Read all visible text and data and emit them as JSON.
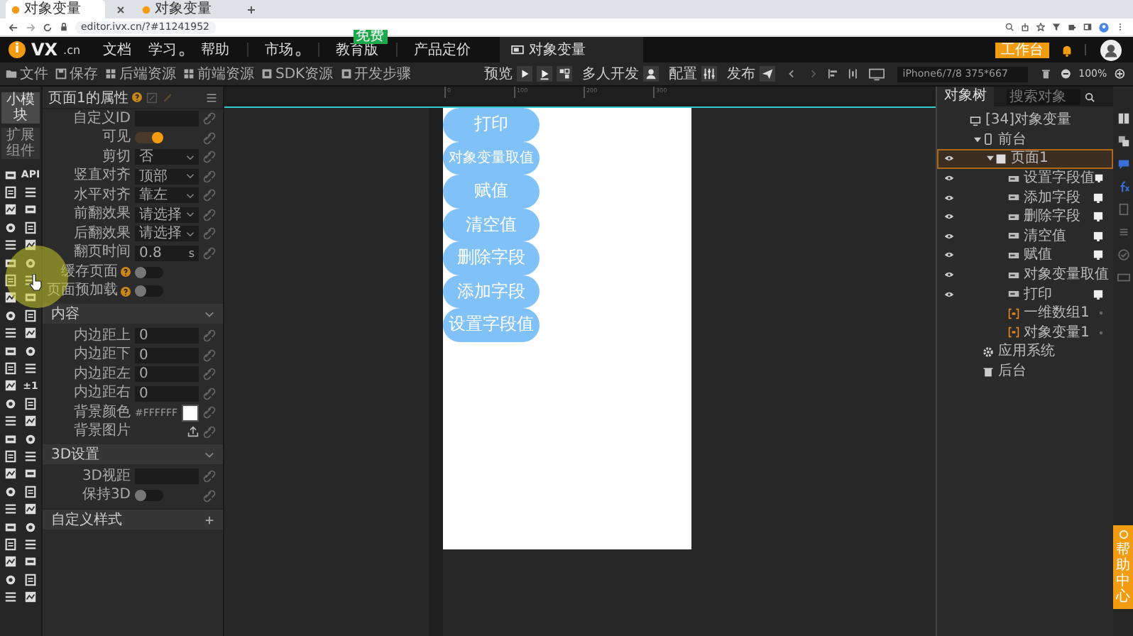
{
  "browser": {
    "tabs": [
      {
        "title": "对象变量",
        "selected": true
      },
      {
        "title": "对象变量",
        "selected": false
      }
    ],
    "address": "editor.ivx.cn/?#11241952"
  },
  "header": {
    "logo": {
      "mark": "i",
      "name": "VX",
      "domain": ".cn"
    },
    "nav": [
      {
        "label": "文档",
        "has_menu": false
      },
      {
        "label": "学习",
        "has_menu": true
      },
      {
        "label": "帮助",
        "has_menu": false
      },
      {
        "label": "市场",
        "has_menu": true
      },
      {
        "label": "教育版",
        "has_menu": false,
        "badge": "免费"
      },
      {
        "label": "产品定价",
        "has_menu": false
      }
    ],
    "project_tab": "对象变量",
    "workbench": "工作台"
  },
  "toolbar": {
    "files": [
      {
        "label": "文件"
      },
      {
        "label": "保存"
      },
      {
        "label": "后端资源"
      },
      {
        "label": "前端资源"
      },
      {
        "label": "SDK资源"
      },
      {
        "label": "开发步骤"
      }
    ],
    "preview": "预览",
    "collab": "多人开发",
    "config": "配置",
    "publish": "发布",
    "device": "iPhone6/7/8 375*667",
    "zoom": "100%"
  },
  "palette": {
    "tabs": [
      {
        "label": "小模块",
        "selected": true
      },
      {
        "label": "扩展组件",
        "selected": false
      }
    ],
    "labels": [
      "API",
      "±1"
    ]
  },
  "panel": {
    "title": "页面1的属性",
    "rows": [
      {
        "kind": "input",
        "label": "自定义ID",
        "link": true
      },
      {
        "kind": "toggle",
        "label": "可见",
        "on": true,
        "link": true
      },
      {
        "kind": "select",
        "label": "剪切",
        "value": "否",
        "link": true
      },
      {
        "kind": "select",
        "label": "竖直对齐",
        "value": "顶部",
        "link": true
      },
      {
        "kind": "select",
        "label": "水平对齐",
        "value": "靠左",
        "link": true
      },
      {
        "kind": "select",
        "label": "前翻效果",
        "value": "请选择",
        "link": true
      },
      {
        "kind": "select",
        "label": "后翻效果",
        "value": "请选择",
        "link": true
      },
      {
        "kind": "input",
        "label": "翻页时间",
        "value": "0.8",
        "unit": "s",
        "link": true
      },
      {
        "kind": "toggle",
        "label": "缓存页面",
        "help": true,
        "on": false,
        "link": false
      },
      {
        "kind": "toggle",
        "label": "页面预加载",
        "help": true,
        "on": false,
        "link": false
      }
    ],
    "sections": [
      {
        "kind": "group",
        "title": "内容",
        "expanded": true,
        "rows": [
          {
            "kind": "input",
            "label": "内边距上",
            "value": "0",
            "link": true
          },
          {
            "kind": "input",
            "label": "内边距下",
            "value": "0",
            "link": true
          },
          {
            "kind": "input",
            "label": "内边距左",
            "value": "0",
            "link": true
          },
          {
            "kind": "input",
            "label": "内边距右",
            "value": "0",
            "link": true
          },
          {
            "kind": "color",
            "label": "背景颜色",
            "value": "#FFFFFF",
            "color": "#ffffff",
            "link": true
          },
          {
            "kind": "upload",
            "label": "背景图片",
            "link": true
          }
        ]
      },
      {
        "kind": "group",
        "title": "3D设置",
        "expanded": true,
        "rows": [
          {
            "kind": "input",
            "label": "3D视距",
            "link": true
          },
          {
            "kind": "toggle",
            "label": "保持3D",
            "on": false,
            "link": true
          }
        ]
      },
      {
        "kind": "add",
        "title": "自定义样式"
      }
    ]
  },
  "canvas": {
    "ruler": [
      "0",
      "100",
      "200",
      "300"
    ],
    "buttons": [
      {
        "label": "打印"
      },
      {
        "label": "对象变量取值"
      },
      {
        "label": "赋值"
      },
      {
        "label": "清空值"
      },
      {
        "label": "删除字段"
      },
      {
        "label": "添加字段"
      },
      {
        "label": "设置字段值"
      }
    ]
  },
  "tree": {
    "tab": "对象树",
    "search_placeholder": "搜索对象",
    "nodes": [
      {
        "kind": "app",
        "label": "[34]对象变量",
        "selected": false,
        "children": [
          {
            "kind": "frontend",
            "label": "前台",
            "expanded": true,
            "selected": false,
            "children": [
              {
                "kind": "page",
                "label": "页面1",
                "expanded": true,
                "selected": true,
                "children": [
                  {
                    "kind": "button",
                    "label": "设置字段值",
                    "selected": false
                  },
                  {
                    "kind": "button",
                    "label": "添加字段",
                    "selected": false
                  },
                  {
                    "kind": "button",
                    "label": "删除字段",
                    "selected": false
                  },
                  {
                    "kind": "button",
                    "label": "清空值",
                    "selected": false
                  },
                  {
                    "kind": "button",
                    "label": "赋值",
                    "selected": false
                  },
                  {
                    "kind": "button",
                    "label": "对象变量取值",
                    "selected": false
                  },
                  {
                    "kind": "button",
                    "label": "打印",
                    "selected": false
                  },
                  {
                    "kind": "array",
                    "label": "一维数组1",
                    "selected": false
                  },
                  {
                    "kind": "object",
                    "label": "对象变量1",
                    "selected": false
                  }
                ]
              }
            ]
          },
          {
            "kind": "system",
            "label": "应用系统",
            "selected": false
          },
          {
            "kind": "backend",
            "label": "后台",
            "selected": false
          }
        ]
      }
    ]
  },
  "help_center": "帮助中心"
}
